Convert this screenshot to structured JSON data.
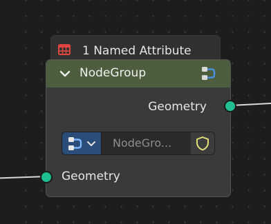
{
  "attribute_tab": {
    "label": "1 Named Attribute",
    "icon": "spreadsheet-icon",
    "icon_color": "#e0463f"
  },
  "node": {
    "title": "NodeGroup",
    "header_color": "#4d5e3e",
    "collapse_icon": "chevron-down-icon",
    "header_icon": "node-tree-icon",
    "output_label": "Geometry",
    "input_label": "Geometry",
    "socket_color": "#1fbf92",
    "selector": {
      "type_icon": "node-tree-icon",
      "dropdown_icon": "chevron-down-icon",
      "name_value": "NodeGro...",
      "fake_user_icon": "shield-icon",
      "shield_color": "#e3e07a"
    }
  }
}
